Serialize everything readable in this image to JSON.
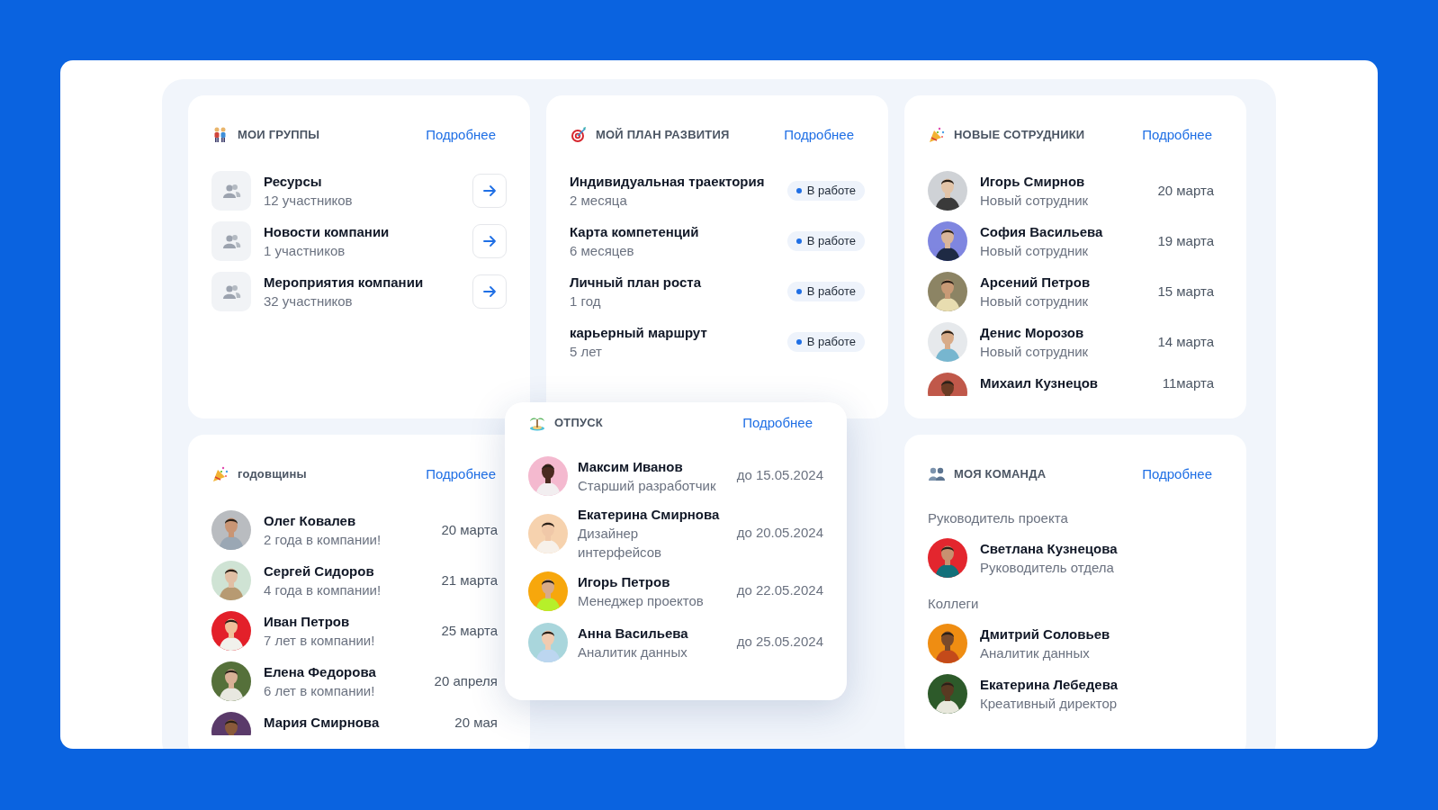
{
  "groups": {
    "title": "МОИ ГРУППЫ",
    "link": "Подробнее",
    "items": [
      {
        "name": "Ресурсы",
        "members": "12 участников"
      },
      {
        "name": "Новости компании",
        "members": "1 участников"
      },
      {
        "name": "Мероприятия компании",
        "members": "32 участников"
      }
    ]
  },
  "plan": {
    "title": "МОЙ ПЛАН РАЗВИТИЯ",
    "link": "Подробнее",
    "items": [
      {
        "name": "Индивидуальная траектория",
        "duration": "2 месяца",
        "status": "В работе"
      },
      {
        "name": "Карта компетенций",
        "duration": "6 месяцев",
        "status": "В работе"
      },
      {
        "name": "Личный план роста",
        "duration": "1 год",
        "status": "В работе"
      },
      {
        "name": "карьерный маршрут",
        "duration": "5 лет",
        "status": "В работе"
      }
    ]
  },
  "new_employees": {
    "title": "НОВЫЕ СОТРУДНИКИ",
    "link": "Подробнее",
    "items": [
      {
        "name": "Игорь Смирнов",
        "role": "Новый сотрудник",
        "date": "20 марта"
      },
      {
        "name": "София Васильева",
        "role": "Новый сотрудник",
        "date": "19 марта"
      },
      {
        "name": "Арсений Петров",
        "role": "Новый сотрудник",
        "date": "15 марта"
      },
      {
        "name": "Денис Морозов",
        "role": "Новый сотрудник",
        "date": "14 марта"
      },
      {
        "name": "Михаил Кузнецов",
        "date": "11марта"
      }
    ]
  },
  "anniversaries": {
    "title": "годовщины",
    "link": "Подробнее",
    "items": [
      {
        "name": "Олег Ковалев",
        "role": "2 года в компании!",
        "date": "20 марта"
      },
      {
        "name": "Сергей Сидоров",
        "role": "4 года в компании!",
        "date": "21 марта"
      },
      {
        "name": "Иван Петров",
        "role": "7 лет в компании!",
        "date": "25 марта"
      },
      {
        "name": "Елена Федорова",
        "role": "6 лет в компании!",
        "date": "20 апреля"
      },
      {
        "name": "Мария Смирнова",
        "date": "20 мая"
      }
    ]
  },
  "vacation": {
    "title": "ОТПУСК",
    "link": "Подробнее",
    "items": [
      {
        "name": "Максим Иванов",
        "role": "Старший разработчик",
        "date": "до 15.05.2024"
      },
      {
        "name": "Екатерина Смирнова",
        "role": "Дизайнер интерфейсов",
        "date": "до 20.05.2024"
      },
      {
        "name": "Игорь Петров",
        "role": "Менеджер проектов",
        "date": "до 22.05.2024"
      },
      {
        "name": "Анна Васильева",
        "role": "Аналитик данных",
        "date": "до 25.05.2024"
      }
    ]
  },
  "team": {
    "title": "МОЯ КОМАНДА",
    "link": "Подробнее",
    "sections": [
      {
        "label": "Руководитель проекта",
        "members": [
          {
            "name": "Светлана Кузнецова",
            "role": "Руководитель отдела"
          }
        ]
      },
      {
        "label": "Коллеги",
        "members": [
          {
            "name": "Дмитрий Соловьев",
            "role": "Аналитик данных"
          },
          {
            "name": "Екатерина Лебедева",
            "role": "Креативный директор"
          }
        ]
      }
    ]
  }
}
